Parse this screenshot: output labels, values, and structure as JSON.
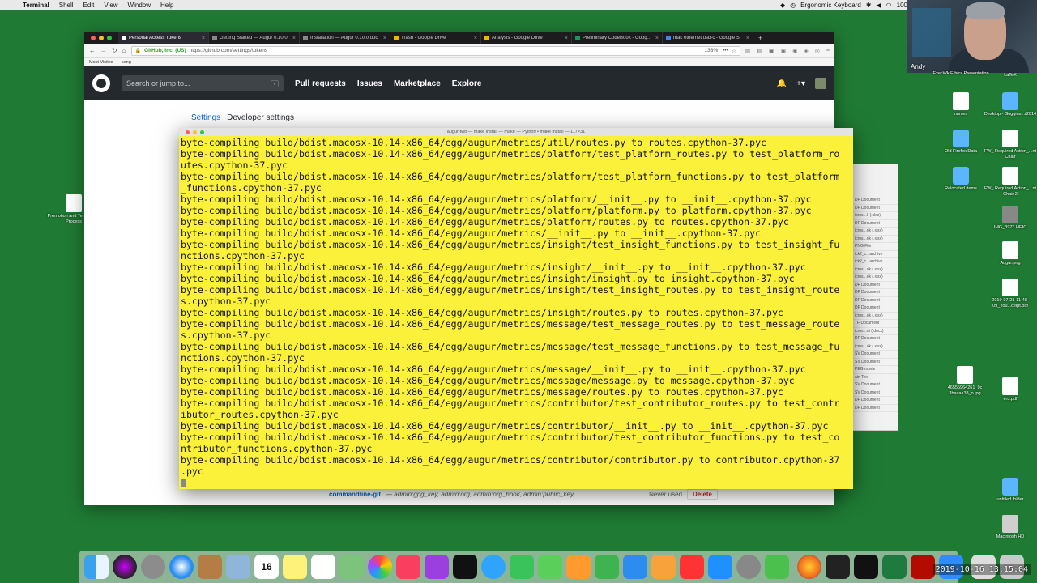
{
  "menubar": {
    "app_name": "Terminal",
    "items": [
      "Shell",
      "Edit",
      "View",
      "Window",
      "Help"
    ],
    "right": [
      "Ergonomic Keyboard",
      "100"
    ]
  },
  "webcam": {
    "name": "Andy"
  },
  "browser": {
    "tabs": [
      {
        "title": "Personal Access Tokens"
      },
      {
        "title": "Getting Started — Augur 0.10.0"
      },
      {
        "title": "Installation — Augur 0.10.0 doc"
      },
      {
        "title": "Trash - Google Drive"
      },
      {
        "title": "Analysis - Google Drive"
      },
      {
        "title": "Preliminary CodeBook - Google S"
      },
      {
        "title": "mac ethernet usb-c - Google S"
      }
    ],
    "newtab": "+",
    "url_org": "GitHub, Inc. (US)",
    "url": "https://github.com/settings/tokens",
    "zoom": "133%",
    "bookmarks": [
      "Most Visited",
      "seng"
    ]
  },
  "github": {
    "search_placeholder": "Search or jump to...",
    "search_key": "/",
    "nav": [
      "Pull requests",
      "Issues",
      "Marketplace",
      "Explore"
    ],
    "plus": "+▾",
    "breadcrumb_settings": "Settings",
    "breadcrumb_developer": "Developer settings",
    "token_name": "commandline-git",
    "token_scopes": "— admin:gpg_key, admin:org, admin:org_hook, admin:public_key,",
    "token_used": "Never used",
    "token_delete": "Delete"
  },
  "terminal": {
    "title": "augur-two — make install — make — Python • make install — 117×31",
    "lines": [
      "byte-compiling build/bdist.macosx-10.14-x86_64/egg/augur/metrics/util/routes.py to routes.cpython-37.pyc",
      "byte-compiling build/bdist.macosx-10.14-x86_64/egg/augur/metrics/platform/test_platform_routes.py to test_platform_ro",
      "utes.cpython-37.pyc",
      "byte-compiling build/bdist.macosx-10.14-x86_64/egg/augur/metrics/platform/test_platform_functions.py to test_platform",
      "_functions.cpython-37.pyc",
      "byte-compiling build/bdist.macosx-10.14-x86_64/egg/augur/metrics/platform/__init__.py to __init__.cpython-37.pyc",
      "byte-compiling build/bdist.macosx-10.14-x86_64/egg/augur/metrics/platform/platform.py to platform.cpython-37.pyc",
      "byte-compiling build/bdist.macosx-10.14-x86_64/egg/augur/metrics/platform/routes.py to routes.cpython-37.pyc",
      "byte-compiling build/bdist.macosx-10.14-x86_64/egg/augur/metrics/__init__.py to __init__.cpython-37.pyc",
      "byte-compiling build/bdist.macosx-10.14-x86_64/egg/augur/metrics/insight/test_insight_functions.py to test_insight_fu",
      "nctions.cpython-37.pyc",
      "byte-compiling build/bdist.macosx-10.14-x86_64/egg/augur/metrics/insight/__init__.py to __init__.cpython-37.pyc",
      "byte-compiling build/bdist.macosx-10.14-x86_64/egg/augur/metrics/insight/insight.py to insight.cpython-37.pyc",
      "byte-compiling build/bdist.macosx-10.14-x86_64/egg/augur/metrics/insight/test_insight_routes.py to test_insight_route",
      "s.cpython-37.pyc",
      "byte-compiling build/bdist.macosx-10.14-x86_64/egg/augur/metrics/insight/routes.py to routes.cpython-37.pyc",
      "byte-compiling build/bdist.macosx-10.14-x86_64/egg/augur/metrics/message/test_message_routes.py to test_message_route",
      "s.cpython-37.pyc",
      "byte-compiling build/bdist.macosx-10.14-x86_64/egg/augur/metrics/message/test_message_functions.py to test_message_fu",
      "nctions.cpython-37.pyc",
      "byte-compiling build/bdist.macosx-10.14-x86_64/egg/augur/metrics/message/__init__.py to __init__.cpython-37.pyc",
      "byte-compiling build/bdist.macosx-10.14-x86_64/egg/augur/metrics/message/message.py to message.cpython-37.pyc",
      "byte-compiling build/bdist.macosx-10.14-x86_64/egg/augur/metrics/message/routes.py to routes.cpython-37.pyc",
      "byte-compiling build/bdist.macosx-10.14-x86_64/egg/augur/metrics/contributor/test_contributor_routes.py to test_contr",
      "ibutor_routes.cpython-37.pyc",
      "byte-compiling build/bdist.macosx-10.14-x86_64/egg/augur/metrics/contributor/__init__.py to __init__.cpython-37.pyc",
      "byte-compiling build/bdist.macosx-10.14-x86_64/egg/augur/metrics/contributor/test_contributor_functions.py to test_co",
      "ntributor_functions.cpython-37.pyc",
      "byte-compiling build/bdist.macosx-10.14-x86_64/egg/augur/metrics/contributor/contributor.py to contributor.cpython-37",
      ".pyc"
    ]
  },
  "finder_rows": [
    "DF Document",
    "DF Document",
    "icros...k (.xlsx)",
    "DF Document",
    "icros...ok (.xlsx)",
    "icros...ok (.xlsx)",
    "PNG File",
    "ick2_c...archive",
    "ick2_c...archive",
    "icros...ok (.xlsx)",
    "icros...ok (.xlsx)",
    "DF Document",
    "DF Document",
    "DF Document",
    "DF Document",
    "icros...ok (.xlsx)",
    "TF Document",
    "icros...nt (.docx)",
    "DF Document",
    "icros...ok (.xlsx)",
    "SV Document",
    "SV Document",
    "PEG movie",
    "ain Text",
    "SV Document",
    "SV Document",
    "DF Document",
    "DF Document"
  ],
  "desktop_icons": [
    {
      "label": "ExecWk Ethics Presentation"
    },
    {
      "label": "LaTeX"
    },
    {
      "label": "names"
    },
    {
      "label": "Desktop - Goggins...r2014"
    },
    {
      "label": "Old Firefox Data"
    },
    {
      "label": "FW_ Required Action_...nt Chair"
    },
    {
      "label": "Relocated Items"
    },
    {
      "label": "FW_ Required Action_...nt Chair 2"
    },
    {
      "label": "IMG_3973.HEIC"
    },
    {
      "label": "Augur.png"
    },
    {
      "label": "2019-07-28-11-48-09_You...ceipt.pdf"
    },
    {
      "label": "46555964261_9c 3bacaa38_o.jpg"
    },
    {
      "label": "erd.pdf"
    },
    {
      "label": "untitled folder"
    },
    {
      "label": "Macintosh HD"
    },
    {
      "label": "Promotion and Tenure /...e Process"
    }
  ],
  "dock": {
    "calendar_day": "16",
    "calendar_month": "OCT"
  },
  "clock": "2019-10-16 13:15:04",
  "colors": {
    "terminal_bg": "#fbf13a",
    "desktop_bg": "#1f7a33",
    "github_header": "#24292e"
  }
}
